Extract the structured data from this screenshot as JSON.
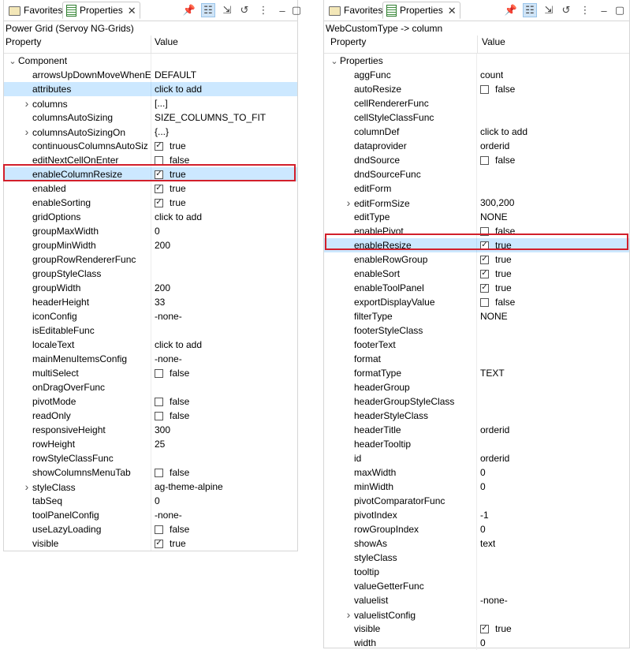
{
  "left": {
    "tabs": [
      {
        "label": "Favorites"
      },
      {
        "label": "Properties"
      }
    ],
    "title": "Power Grid (Servoy NG-Grids)",
    "col_property": "Property",
    "col_value": "Value",
    "rows": [
      {
        "name": "Component",
        "value": "",
        "indent": 0,
        "exp": "v",
        "check": null
      },
      {
        "name": "arrowsUpDownMoveWhenE",
        "value": "DEFAULT",
        "indent": 1,
        "exp": "",
        "check": null
      },
      {
        "name": "attributes",
        "value": "click to add",
        "indent": 1,
        "exp": "",
        "check": null,
        "sel": true
      },
      {
        "name": "columns",
        "value": "[...]",
        "indent": 1,
        "exp": ">",
        "check": null
      },
      {
        "name": "columnsAutoSizing",
        "value": "SIZE_COLUMNS_TO_FIT",
        "indent": 1,
        "exp": "",
        "check": null
      },
      {
        "name": "columnsAutoSizingOn",
        "value": "{...}",
        "indent": 1,
        "exp": ">",
        "check": null
      },
      {
        "name": "continuousColumnsAutoSiz",
        "value": "true",
        "indent": 1,
        "exp": "",
        "check": true
      },
      {
        "name": "editNextCellOnEnter",
        "value": "false",
        "indent": 1,
        "exp": "",
        "check": false
      },
      {
        "name": "enableColumnResize",
        "value": "true",
        "indent": 1,
        "exp": "",
        "check": true,
        "sel": true
      },
      {
        "name": "enabled",
        "value": "true",
        "indent": 1,
        "exp": "",
        "check": true
      },
      {
        "name": "enableSorting",
        "value": "true",
        "indent": 1,
        "exp": "",
        "check": true
      },
      {
        "name": "gridOptions",
        "value": "click to add",
        "indent": 1,
        "exp": "",
        "check": null
      },
      {
        "name": "groupMaxWidth",
        "value": "0",
        "indent": 1,
        "exp": "",
        "check": null
      },
      {
        "name": "groupMinWidth",
        "value": "200",
        "indent": 1,
        "exp": "",
        "check": null
      },
      {
        "name": "groupRowRendererFunc",
        "value": "",
        "indent": 1,
        "exp": "",
        "check": null
      },
      {
        "name": "groupStyleClass",
        "value": "",
        "indent": 1,
        "exp": "",
        "check": null
      },
      {
        "name": "groupWidth",
        "value": "200",
        "indent": 1,
        "exp": "",
        "check": null
      },
      {
        "name": "headerHeight",
        "value": "33",
        "indent": 1,
        "exp": "",
        "check": null
      },
      {
        "name": "iconConfig",
        "value": "-none-",
        "indent": 1,
        "exp": "",
        "check": null
      },
      {
        "name": "isEditableFunc",
        "value": "",
        "indent": 1,
        "exp": "",
        "check": null
      },
      {
        "name": "localeText",
        "value": "click to add",
        "indent": 1,
        "exp": "",
        "check": null
      },
      {
        "name": "mainMenuItemsConfig",
        "value": "-none-",
        "indent": 1,
        "exp": "",
        "check": null
      },
      {
        "name": "multiSelect",
        "value": "false",
        "indent": 1,
        "exp": "",
        "check": false
      },
      {
        "name": "onDragOverFunc",
        "value": "",
        "indent": 1,
        "exp": "",
        "check": null
      },
      {
        "name": "pivotMode",
        "value": "false",
        "indent": 1,
        "exp": "",
        "check": false
      },
      {
        "name": "readOnly",
        "value": "false",
        "indent": 1,
        "exp": "",
        "check": false
      },
      {
        "name": "responsiveHeight",
        "value": "300",
        "indent": 1,
        "exp": "",
        "check": null
      },
      {
        "name": "rowHeight",
        "value": "25",
        "indent": 1,
        "exp": "",
        "check": null
      },
      {
        "name": "rowStyleClassFunc",
        "value": "",
        "indent": 1,
        "exp": "",
        "check": null
      },
      {
        "name": "showColumnsMenuTab",
        "value": "false",
        "indent": 1,
        "exp": "",
        "check": false
      },
      {
        "name": "styleClass",
        "value": "ag-theme-alpine",
        "indent": 1,
        "exp": ">",
        "check": null
      },
      {
        "name": "tabSeq",
        "value": "0",
        "indent": 1,
        "exp": "",
        "check": null
      },
      {
        "name": "toolPanelConfig",
        "value": "-none-",
        "indent": 1,
        "exp": "",
        "check": null
      },
      {
        "name": "useLazyLoading",
        "value": "false",
        "indent": 1,
        "exp": "",
        "check": false
      },
      {
        "name": "visible",
        "value": "true",
        "indent": 1,
        "exp": "",
        "check": true
      }
    ]
  },
  "right": {
    "tabs": [
      {
        "label": "Favorites"
      },
      {
        "label": "Properties"
      }
    ],
    "title": "WebCustomType -> column",
    "col_property": "Property",
    "col_value": "Value",
    "rows": [
      {
        "name": "Properties",
        "value": "",
        "indent": 0,
        "exp": "v",
        "check": null
      },
      {
        "name": "aggFunc",
        "value": "count",
        "indent": 1,
        "exp": "",
        "check": null
      },
      {
        "name": "autoResize",
        "value": "false",
        "indent": 1,
        "exp": "",
        "check": false
      },
      {
        "name": "cellRendererFunc",
        "value": "",
        "indent": 1,
        "exp": "",
        "check": null
      },
      {
        "name": "cellStyleClassFunc",
        "value": "",
        "indent": 1,
        "exp": "",
        "check": null
      },
      {
        "name": "columnDef",
        "value": "click to add",
        "indent": 1,
        "exp": "",
        "check": null
      },
      {
        "name": "dataprovider",
        "value": "orderid",
        "indent": 1,
        "exp": "",
        "check": null
      },
      {
        "name": "dndSource",
        "value": "false",
        "indent": 1,
        "exp": "",
        "check": false
      },
      {
        "name": "dndSourceFunc",
        "value": "",
        "indent": 1,
        "exp": "",
        "check": null
      },
      {
        "name": "editForm",
        "value": "",
        "indent": 1,
        "exp": "",
        "check": null
      },
      {
        "name": "editFormSize",
        "value": "300,200",
        "indent": 1,
        "exp": ">",
        "check": null
      },
      {
        "name": "editType",
        "value": "NONE",
        "indent": 1,
        "exp": "",
        "check": null
      },
      {
        "name": "enablePivot",
        "value": "false",
        "indent": 1,
        "exp": "",
        "check": false
      },
      {
        "name": "enableResize",
        "value": "true",
        "indent": 1,
        "exp": "",
        "check": true,
        "sel": true
      },
      {
        "name": "enableRowGroup",
        "value": "true",
        "indent": 1,
        "exp": "",
        "check": true
      },
      {
        "name": "enableSort",
        "value": "true",
        "indent": 1,
        "exp": "",
        "check": true
      },
      {
        "name": "enableToolPanel",
        "value": "true",
        "indent": 1,
        "exp": "",
        "check": true
      },
      {
        "name": "exportDisplayValue",
        "value": "false",
        "indent": 1,
        "exp": "",
        "check": false
      },
      {
        "name": "filterType",
        "value": "NONE",
        "indent": 1,
        "exp": "",
        "check": null
      },
      {
        "name": "footerStyleClass",
        "value": "",
        "indent": 1,
        "exp": "",
        "check": null
      },
      {
        "name": "footerText",
        "value": "",
        "indent": 1,
        "exp": "",
        "check": null
      },
      {
        "name": "format",
        "value": "",
        "indent": 1,
        "exp": "",
        "check": null
      },
      {
        "name": "formatType",
        "value": "TEXT",
        "indent": 1,
        "exp": "",
        "check": null
      },
      {
        "name": "headerGroup",
        "value": "",
        "indent": 1,
        "exp": "",
        "check": null
      },
      {
        "name": "headerGroupStyleClass",
        "value": "",
        "indent": 1,
        "exp": "",
        "check": null
      },
      {
        "name": "headerStyleClass",
        "value": "",
        "indent": 1,
        "exp": "",
        "check": null
      },
      {
        "name": "headerTitle",
        "value": "orderid",
        "indent": 1,
        "exp": "",
        "check": null
      },
      {
        "name": "headerTooltip",
        "value": "",
        "indent": 1,
        "exp": "",
        "check": null
      },
      {
        "name": "id",
        "value": "orderid",
        "indent": 1,
        "exp": "",
        "check": null
      },
      {
        "name": "maxWidth",
        "value": "0",
        "indent": 1,
        "exp": "",
        "check": null
      },
      {
        "name": "minWidth",
        "value": "0",
        "indent": 1,
        "exp": "",
        "check": null
      },
      {
        "name": "pivotComparatorFunc",
        "value": "",
        "indent": 1,
        "exp": "",
        "check": null
      },
      {
        "name": "pivotIndex",
        "value": "-1",
        "indent": 1,
        "exp": "",
        "check": null
      },
      {
        "name": "rowGroupIndex",
        "value": "0",
        "indent": 1,
        "exp": "",
        "check": null
      },
      {
        "name": "showAs",
        "value": "text",
        "indent": 1,
        "exp": "",
        "check": null
      },
      {
        "name": "styleClass",
        "value": "",
        "indent": 1,
        "exp": "",
        "check": null
      },
      {
        "name": "tooltip",
        "value": "",
        "indent": 1,
        "exp": "",
        "check": null
      },
      {
        "name": "valueGetterFunc",
        "value": "",
        "indent": 1,
        "exp": "",
        "check": null
      },
      {
        "name": "valuelist",
        "value": "-none-",
        "indent": 1,
        "exp": "",
        "check": null
      },
      {
        "name": "valuelistConfig",
        "value": "",
        "indent": 1,
        "exp": ">",
        "check": null
      },
      {
        "name": "visible",
        "value": "true",
        "indent": 1,
        "exp": "",
        "check": true
      },
      {
        "name": "width",
        "value": "0",
        "indent": 1,
        "exp": "",
        "check": null
      }
    ]
  },
  "icons": {
    "pin": "pin-icon",
    "tree": "tree-view-icon",
    "export": "export-icon",
    "refresh": "refresh-icon",
    "menu": "view-menu-icon"
  },
  "colors": {
    "selection": "#cce8ff",
    "highlight": "#d21f2b",
    "toolbar_active": "#cfe4f7"
  }
}
